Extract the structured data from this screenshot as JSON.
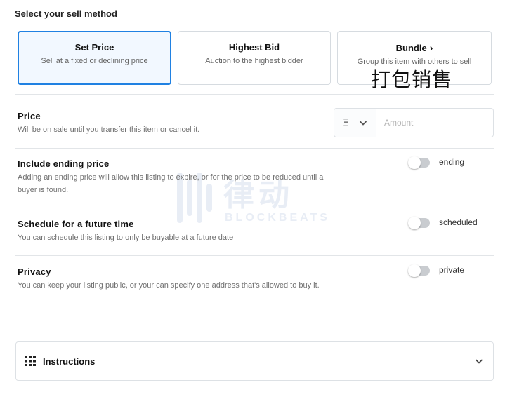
{
  "heading": "Select your sell method",
  "methods": [
    {
      "title": "Set Price",
      "desc": "Sell at a fixed or declining price"
    },
    {
      "title": "Highest Bid",
      "desc": "Auction to the highest bidder"
    },
    {
      "title": "Bundle",
      "desc": "Group this item with others to sell"
    }
  ],
  "bundle_overlay": "打包销售",
  "price": {
    "title": "Price",
    "desc": "Will be on sale until you transfer this item or cancel it.",
    "token_symbol": "Ξ",
    "amount_placeholder": "Amount"
  },
  "ending": {
    "title": "Include ending price",
    "desc": "Adding an ending price will allow this listing to expire, or for the price to be reduced until a buyer is found.",
    "toggle_label": "ending",
    "enabled": false
  },
  "schedule": {
    "title": "Schedule for a future time",
    "desc": "You can schedule this listing to only be buyable at a future date",
    "toggle_label": "scheduled",
    "enabled": false
  },
  "privacy": {
    "title": "Privacy",
    "desc": "You can keep your listing public, or your can specify one address that's allowed to buy it.",
    "toggle_label": "private",
    "enabled": false
  },
  "instructions": {
    "label": "Instructions"
  },
  "watermark": {
    "cn": "律动",
    "en": "BLOCKBEATS"
  },
  "colors": {
    "accent": "#2081e2",
    "selected_bg": "#f2f8ff",
    "toggle_off": "#c9ccd0"
  }
}
